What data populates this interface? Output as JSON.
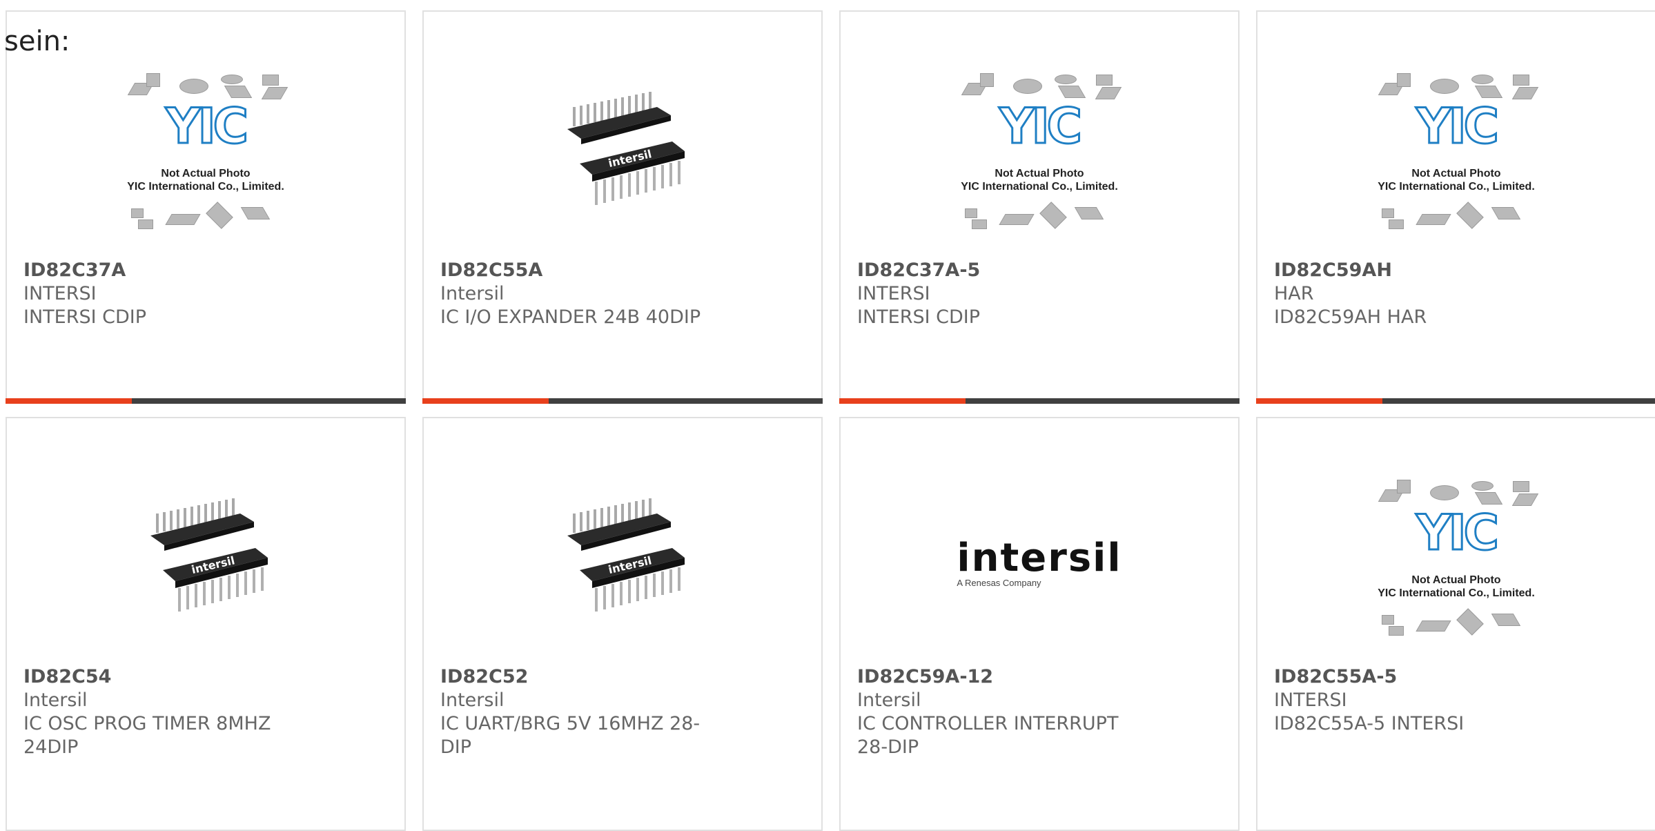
{
  "heading": "sein:",
  "products": [
    {
      "part": "ID82C37A",
      "manufacturer": "INTERSI",
      "description": "INTERSI CDIP",
      "image": "yic-placeholder"
    },
    {
      "part": "ID82C55A",
      "manufacturer": "Intersil",
      "description": "IC I/O EXPANDER 24B 40DIP",
      "image": "dip-chip"
    },
    {
      "part": "ID82C37A-5",
      "manufacturer": "INTERSI",
      "description": "INTERSI CDIP",
      "image": "yic-placeholder"
    },
    {
      "part": "ID82C59AH",
      "manufacturer": "HAR",
      "description": "ID82C59AH HAR",
      "image": "yic-placeholder"
    },
    {
      "part": "ID82C54",
      "manufacturer": "Intersil",
      "description": "IC OSC PROG TIMER 8MHZ 24DIP",
      "image": "dip-chip"
    },
    {
      "part": "ID82C52",
      "manufacturer": "Intersil",
      "description": "IC UART/BRG 5V 16MHZ 28-DIP",
      "image": "dip-chip"
    },
    {
      "part": "ID82C59A-12",
      "manufacturer": "Intersil",
      "description": "IC CONTROLLER INTERRUPT 28-DIP",
      "image": "intersil-logo"
    },
    {
      "part": "ID82C55A-5",
      "manufacturer": "INTERSI",
      "description": "ID82C55A-5 INTERSI",
      "image": "yic-placeholder"
    }
  ],
  "placeholder": {
    "logo": "YIC",
    "caption_line1": "Not Actual Photo",
    "caption_line2": "YIC International Co., Limited."
  },
  "chip_marking": "intersil",
  "brand": {
    "name": "intersil",
    "tagline": "A Renesas Company"
  },
  "colors": {
    "accent": "#e8401c",
    "bar": "#404040",
    "border": "#e0e0e0",
    "yic_blue": "#1f7fc4"
  }
}
